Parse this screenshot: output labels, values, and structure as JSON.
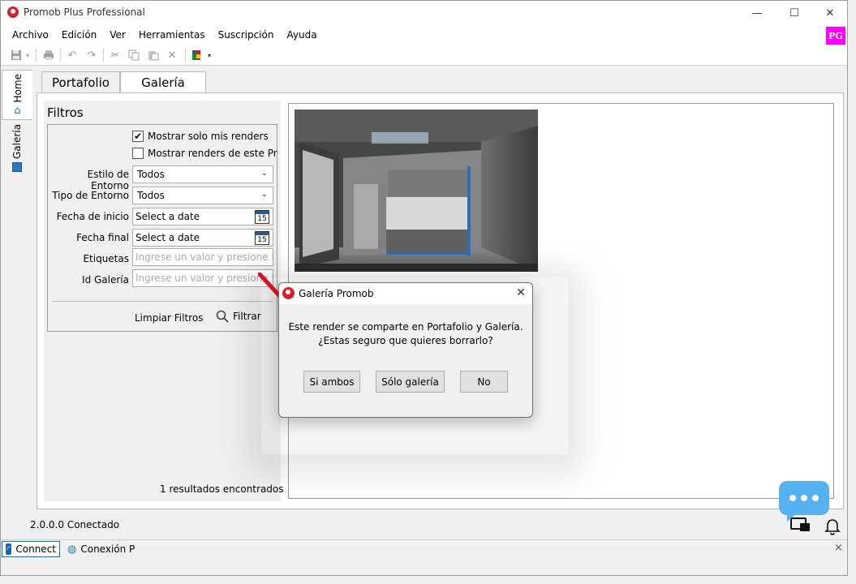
{
  "window": {
    "title": "Promob Plus Professional",
    "minimize": "—",
    "maximize": "☐",
    "close": "✕"
  },
  "menu": [
    "Archivo",
    "Edición",
    "Ver",
    "Herramientas",
    "Suscripción",
    "Ayuda"
  ],
  "user_badge": "PG",
  "side_tabs": {
    "home": "Home",
    "gallery": "Galería"
  },
  "tabs": {
    "portfolio": "Portafolio",
    "gallery": "Galería"
  },
  "filters": {
    "title": "Filtros",
    "only_mine": {
      "label": "Mostrar solo mis renders",
      "checked": true
    },
    "this_promob": {
      "label": "Mostrar renders de este Prom",
      "checked": false
    },
    "env_style": {
      "label": "Estilo de Entorno",
      "value": "Todos"
    },
    "env_type": {
      "label": "Tipo de Entorno",
      "value": "Todos"
    },
    "start_date": {
      "label": "Fecha de inicio",
      "value": "Select a date",
      "cal": "15"
    },
    "end_date": {
      "label": "Fecha final",
      "value": "Select a date",
      "cal": "15"
    },
    "tags": {
      "label": "Etiquetas",
      "placeholder": "Ingrese un valor y presione la te"
    },
    "gallery_id": {
      "label": "Id Galería",
      "placeholder": "Ingrese un valor y presione la te"
    },
    "clear": "Limpiar Filtros",
    "filter": "Filtrar",
    "results": "1 resultados encontrados"
  },
  "status": {
    "version": "2.0.0.0",
    "connection": "Conectado"
  },
  "bottom_tabs": {
    "connect": "Connect",
    "conexion": "Conexión P",
    "close": "×"
  },
  "dialog": {
    "title": "Galería Promob",
    "close": "✕",
    "message_line1": "Este render se comparte en Portafolio y Galería.",
    "message_line2": "¿Estas seguro que quieres borrarlo?",
    "btn_both": "Si ambos",
    "btn_gallery_only": "Sólo galería",
    "btn_no": "No"
  }
}
